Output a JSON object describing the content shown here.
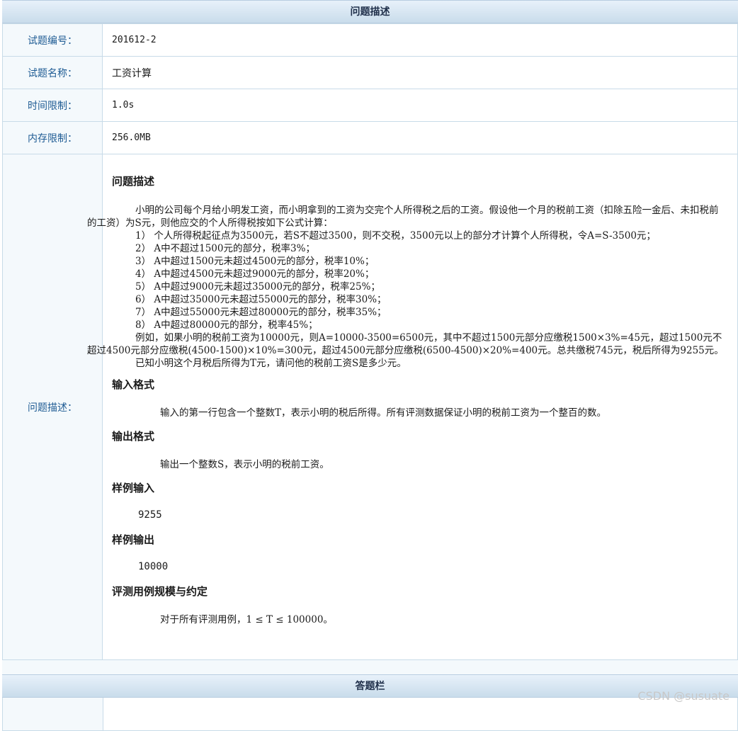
{
  "header": {
    "title": "问题描述"
  },
  "fields": [
    {
      "label": "试题编号：",
      "value": "201612-2"
    },
    {
      "label": "试题名称：",
      "value": "工资计算"
    },
    {
      "label": "时间限制：",
      "value": "1.0s"
    },
    {
      "label": "内存限制：",
      "value": "256.0MB"
    }
  ],
  "description": {
    "label": "问题描述：",
    "title": "问题描述",
    "intro": "小明的公司每个月给小明发工资，而小明拿到的工资为交完个人所得税之后的工资。假设他一个月的税前工资（扣除五险一金后、未扣税前的工资）为S元，则他应交的个人所得税按如下公式计算：",
    "rules": [
      "1）  个人所得税起征点为3500元，若S不超过3500，则不交税，3500元以上的部分才计算个人所得税，令A=S-3500元；",
      "2）  A中不超过1500元的部分，税率3%；",
      "3）  A中超过1500元未超过4500元的部分，税率10%；",
      "4）  A中超过4500元未超过9000元的部分，税率20%；",
      "5）  A中超过9000元未超过35000元的部分，税率25%；",
      "6）  A中超过35000元未超过55000元的部分，税率30%；",
      "7）  A中超过55000元未超过80000元的部分，税率35%；",
      "8）  A中超过80000元的部分，税率45%；"
    ],
    "example": "例如，如果小明的税前工资为10000元，则A=10000-3500=6500元，其中不超过1500元部分应缴税1500×3%=45元，超过1500元不超过4500元部分应缴税(4500-1500)×10%=300元，超过4500元部分应缴税(6500-4500)×20%=400元。总共缴税745元，税后所得为9255元。",
    "question": "已知小明这个月税后所得为T元，请问他的税前工资S是多少元。",
    "input_title": "输入格式",
    "input_text": "输入的第一行包含一个整数T，表示小明的税后所得。所有评测数据保证小明的税前工资为一个整百的数。",
    "output_title": "输出格式",
    "output_text": "输出一个整数S，表示小明的税前工资。",
    "sample_in_title": "样例输入",
    "sample_in": "9255",
    "sample_out_title": "样例输出",
    "sample_out": "10000",
    "scale_title": "评测用例规模与约定",
    "scale_text": "对于所有评测用例，1 ≤ T ≤ 100000。"
  },
  "answer": {
    "title": "答题栏"
  },
  "watermark": "CSDN @susuate"
}
